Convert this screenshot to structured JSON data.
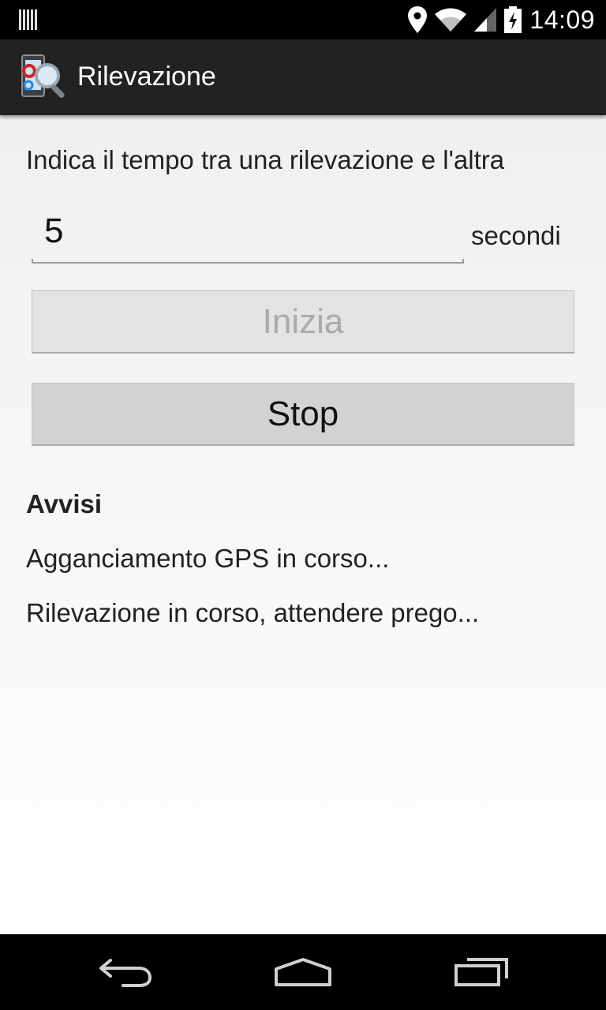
{
  "status_bar": {
    "time": "14:09",
    "icons": [
      "barcode-icon",
      "location-icon",
      "wifi-icon",
      "signal-icon",
      "battery-charging-icon"
    ]
  },
  "action_bar": {
    "title": "Rilevazione",
    "icon": "app-gear-magnifier-icon"
  },
  "form": {
    "instruction": "Indica il tempo tra una rilevazione e l'altra",
    "interval_value": "5",
    "unit_label": "secondi",
    "start_button": "Inizia",
    "stop_button": "Stop"
  },
  "notices": {
    "title": "Avvisi",
    "items": [
      "Agganciamento GPS in corso...",
      "Rilevazione in corso, attendere prego..."
    ]
  },
  "nav_bar": {
    "icons": [
      "back-icon",
      "home-icon",
      "recents-icon"
    ]
  },
  "colors": {
    "status_bar": "#000000",
    "action_bar": "#222222",
    "content_bg": "#f0f0f0",
    "disabled_text": "#aaaaaa"
  }
}
